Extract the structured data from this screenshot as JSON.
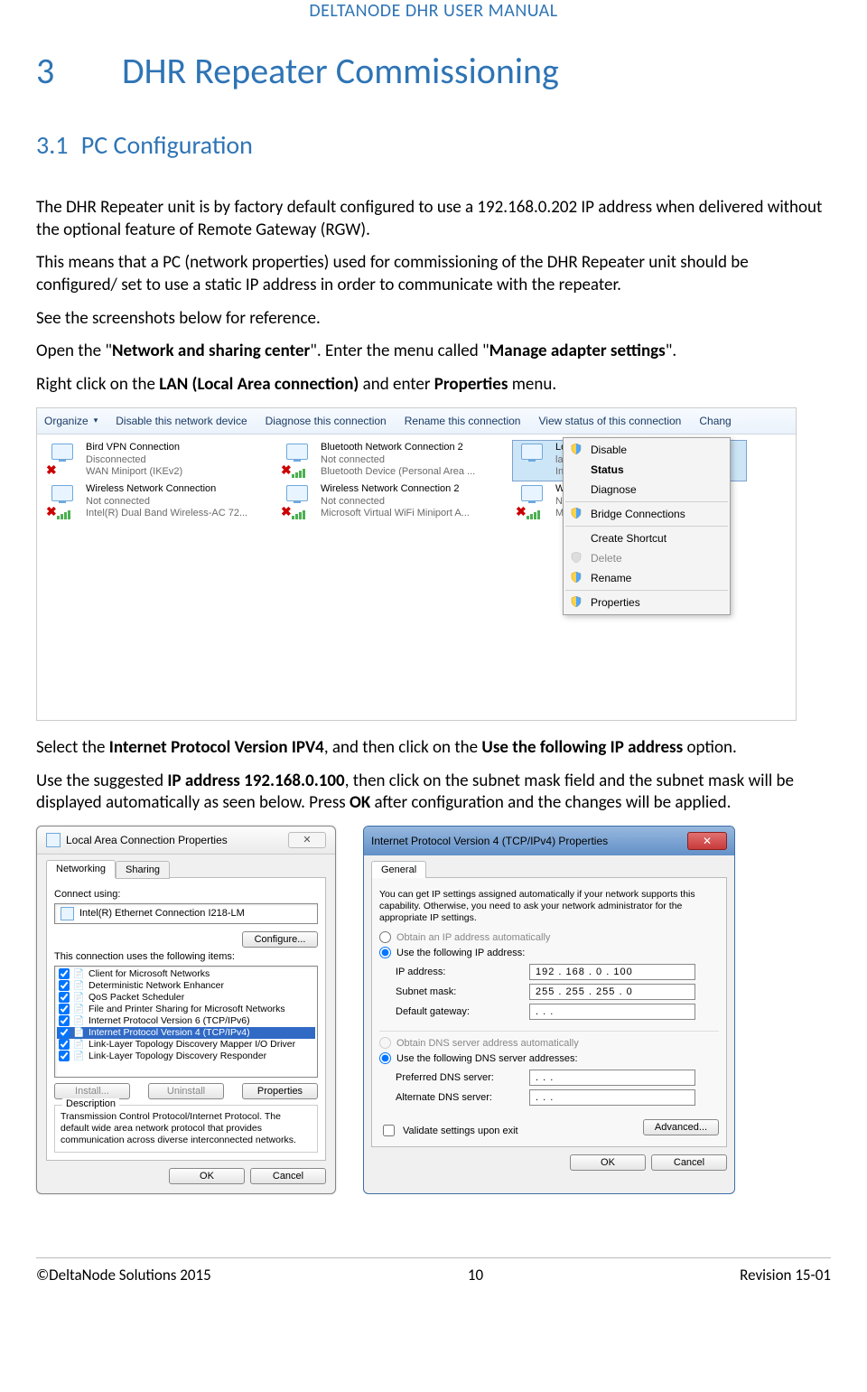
{
  "doc_header": "DELTANODE DHR USER MANUAL",
  "chapter": {
    "num": "3",
    "title": "DHR Repeater Commissioning"
  },
  "section": {
    "num": "3.1",
    "title": "PC Configuration"
  },
  "para1": "The DHR Repeater unit is by factory default configured to use a 192.168.0.202 IP address when delivered without the optional feature of Remote Gateway (RGW).",
  "para2": "This means that a PC (network properties) used for commissioning of the DHR Repeater unit should be configured/ set to use a static IP address in order to communicate with the repeater.",
  "para3": "See the screenshots below for reference.",
  "para4_pre": "Open the \"",
  "para4_b1": "Network and sharing center",
  "para4_mid": "\". Enter the menu called \"",
  "para4_b2": "Manage adapter settings",
  "para4_post": "\".",
  "para5_pre": "Right click on the ",
  "para5_b1": "LAN (Local Area connection)",
  "para5_mid": " and enter ",
  "para5_b2": "Properties",
  "para5_post": " menu.",
  "para6_pre": "Select the ",
  "para6_b1": "Internet Protocol Version IPV4",
  "para6_mid": ", and then click on the ",
  "para6_b2": "Use the following IP address",
  "para6_post": " option.",
  "para7_pre": "Use the suggested ",
  "para7_b1": "IP address 192.168.0.100",
  "para7_mid": ", then click on the subnet mask field and the subnet mask will be displayed automatically as seen below. Press ",
  "para7_b2": "OK",
  "para7_post": " after configuration and the changes will be applied.",
  "s1": {
    "toolbar": {
      "organize": "Organize",
      "disable": "Disable this network device",
      "diagnose": "Diagnose this connection",
      "rename": "Rename this connection",
      "viewstatus": "View status of this connection",
      "change": "Chang"
    },
    "items": [
      {
        "title": "Bird VPN Connection",
        "status": "Disconnected",
        "device": "WAN Miniport (IKEv2)",
        "x": true,
        "bars": false
      },
      {
        "title": "Bluetooth Network Connection 2",
        "status": "Not connected",
        "device": "Bluetooth Device (Personal Area ...",
        "x": true,
        "bars": true
      },
      {
        "title": "Local Area Connection",
        "status": "lansou",
        "device": "Intel(R)",
        "x": false,
        "bars": false,
        "selected": true
      },
      {
        "title": "Wireless Network Connection",
        "status": "Not connected",
        "device": "Intel(R) Dual Band Wireless-AC 72...",
        "x": true,
        "bars": true
      },
      {
        "title": "Wireless Network Connection 2",
        "status": "Not connected",
        "device": "Microsoft Virtual WiFi Miniport A...",
        "x": true,
        "bars": true
      },
      {
        "title": "Wirele",
        "status": "Not co",
        "device": "Micros",
        "x": true,
        "bars": true
      }
    ],
    "ctx": {
      "disable": "Disable",
      "status": "Status",
      "diagnose": "Diagnose",
      "bridge": "Bridge Connections",
      "shortcut": "Create Shortcut",
      "delete": "Delete",
      "rename": "Rename",
      "properties": "Properties"
    }
  },
  "lanprops": {
    "title": "Local Area Connection Properties",
    "tab_networking": "Networking",
    "tab_sharing": "Sharing",
    "connect_using": "Connect using:",
    "adapter": "Intel(R) Ethernet Connection I218-LM",
    "configure": "Configure...",
    "uses_label": "This connection uses the following items:",
    "items": [
      "Client for Microsoft Networks",
      "Deterministic Network Enhancer",
      "QoS Packet Scheduler",
      "File and Printer Sharing for Microsoft Networks",
      "Internet Protocol Version 6 (TCP/IPv6)",
      "Internet Protocol Version 4 (TCP/IPv4)",
      "Link-Layer Topology Discovery Mapper I/O Driver",
      "Link-Layer Topology Discovery Responder"
    ],
    "install": "Install...",
    "uninstall": "Uninstall",
    "properties": "Properties",
    "desc_label": "Description",
    "desc_text": "Transmission Control Protocol/Internet Protocol. The default wide area network protocol that provides communication across diverse interconnected networks.",
    "ok": "OK",
    "cancel": "Cancel"
  },
  "ipv4": {
    "title": "Internet Protocol Version 4 (TCP/IPv4) Properties",
    "tab_general": "General",
    "intro": "You can get IP settings assigned automatically if your network supports this capability. Otherwise, you need to ask your network administrator for the appropriate IP settings.",
    "r_auto_ip": "Obtain an IP address automatically",
    "r_use_ip": "Use the following IP address:",
    "ip_label": "IP address:",
    "ip_value": "192 . 168 .  0  . 100",
    "mask_label": "Subnet mask:",
    "mask_value": "255 . 255 . 255 .  0",
    "gw_label": "Default gateway:",
    "gw_value": " .       .       . ",
    "r_auto_dns": "Obtain DNS server address automatically",
    "r_use_dns": "Use the following DNS server addresses:",
    "pdns_label": "Preferred DNS server:",
    "pdns_value": " .       .       . ",
    "adns_label": "Alternate DNS server:",
    "adns_value": " .       .       . ",
    "validate": "Validate settings upon exit",
    "advanced": "Advanced...",
    "ok": "OK",
    "cancel": "Cancel"
  },
  "footer": {
    "left": "©DeltaNode Solutions 2015",
    "center": "10",
    "right": "Revision 15-01"
  }
}
